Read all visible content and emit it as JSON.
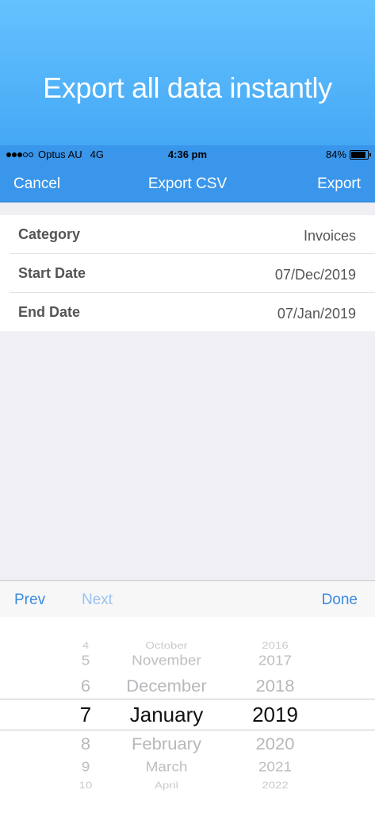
{
  "promo": {
    "title": "Export all data instantly"
  },
  "status_bar": {
    "carrier": "Optus AU",
    "network": "4G",
    "time": "4:36 pm",
    "battery": "84%",
    "signal_bars_filled": 3,
    "signal_bars_total": 5
  },
  "nav": {
    "cancel": "Cancel",
    "title": "Export CSV",
    "export": "Export"
  },
  "form": {
    "rows": [
      {
        "label": "Category",
        "value": "Invoices"
      },
      {
        "label": "Start Date",
        "value": "07/Dec/2019"
      },
      {
        "label": "End Date",
        "value": "07/Jan/2019"
      }
    ]
  },
  "toolbar": {
    "prev": "Prev",
    "next": "Next",
    "done": "Done"
  },
  "picker": {
    "days": [
      "4",
      "5",
      "6",
      "7",
      "8",
      "9",
      "10"
    ],
    "months": [
      "October",
      "November",
      "December",
      "January",
      "February",
      "March",
      "April"
    ],
    "years": [
      "2016",
      "2017",
      "2018",
      "2019",
      "2020",
      "2021",
      "2022"
    ],
    "selected": {
      "day": "7",
      "month": "January",
      "year": "2019"
    }
  },
  "colors": {
    "nav_blue": "#3a96ea",
    "link_blue": "#3a8be0",
    "promo_top": "#64c2fe"
  }
}
